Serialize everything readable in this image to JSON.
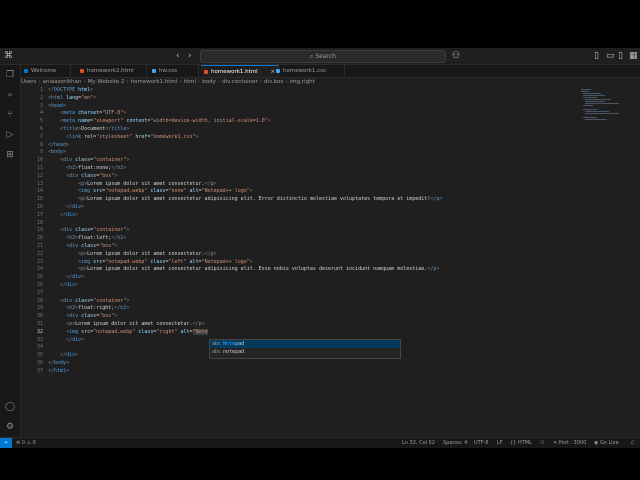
{
  "titlebar": {
    "search_label": "Search",
    "search_icon": "search-icon"
  },
  "tabs": [
    {
      "label": "Welcome",
      "color": "#0078d4"
    },
    {
      "label": "homework2.html",
      "color": "#e44d26"
    },
    {
      "label": "hw.css",
      "color": "#42a5f5"
    },
    {
      "label": "homework1.html",
      "color": "#e44d26"
    },
    {
      "label": "homework1.css",
      "color": "#42a5f5"
    }
  ],
  "breadcrumb": [
    "Users",
    "aniaazorikhan",
    "My Website 2",
    "homework1.html",
    "html",
    "body",
    "div.container",
    "div.box",
    "img.right"
  ],
  "line_numbers": [
    "1",
    "2",
    "3",
    "4",
    "5",
    "6",
    "7",
    "8",
    "9",
    "10",
    "11",
    "12",
    "13",
    "14",
    "15",
    "16",
    "17",
    "18",
    "19",
    "20",
    "21",
    "22",
    "23",
    "24",
    "25",
    "26",
    "27",
    "28",
    "29",
    "30",
    "31",
    "32",
    "33",
    "34",
    "35",
    "36",
    "37"
  ],
  "current_line": "32",
  "suggestions": [
    {
      "kind": "abc",
      "match": "Note",
      "rest": "pad"
    },
    {
      "kind": "abc",
      "match": "",
      "rest": "notepad"
    }
  ],
  "statusbar": {
    "errors": "0",
    "warnings": "0",
    "position": "Ln 32, Col 52",
    "spaces": "Spaces: 4",
    "encoding": "UTF-8",
    "eol": "LF",
    "language": "HTML",
    "port": "Port : 3000",
    "golive": "Go Live"
  }
}
